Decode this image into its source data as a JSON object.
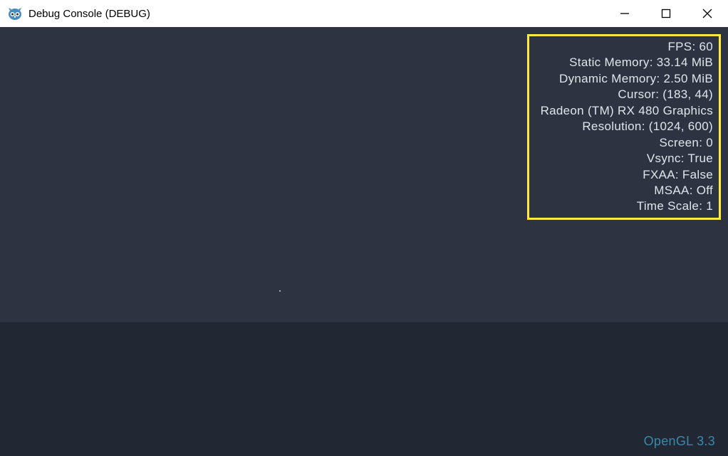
{
  "window": {
    "title": "Debug Console (DEBUG)"
  },
  "stats": {
    "fps": {
      "label": "FPS",
      "value": "60"
    },
    "static_memory": {
      "label": "Static Memory",
      "value": "33.14 MiB"
    },
    "dynamic_memory": {
      "label": "Dynamic Memory",
      "value": "2.50 MiB"
    },
    "cursor": {
      "label": "Cursor",
      "value": "(183, 44)"
    },
    "gpu": "Radeon (TM) RX 480 Graphics",
    "resolution": {
      "label": "Resolution",
      "value": "(1024, 600)"
    },
    "screen": {
      "label": "Screen",
      "value": "0"
    },
    "vsync": {
      "label": "Vsync",
      "value": "True"
    },
    "fxaa": {
      "label": "FXAA",
      "value": "False"
    },
    "msaa": {
      "label": "MSAA",
      "value": "Off"
    },
    "time_scale": {
      "label": "Time Scale",
      "value": "1"
    }
  },
  "footer": {
    "gl_version": "OpenGL 3.3"
  }
}
